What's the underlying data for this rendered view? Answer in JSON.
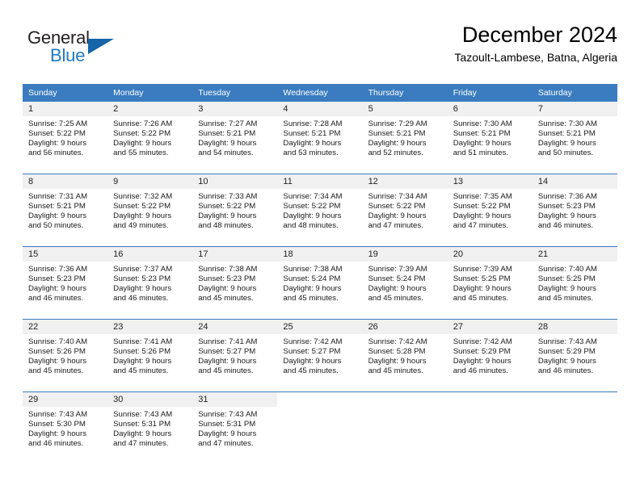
{
  "brand": {
    "name_part1": "General",
    "name_part2": "Blue",
    "triangle_color": "#1565a8",
    "blue_text_color": "#1f7ac0"
  },
  "header": {
    "title": "December 2024",
    "subtitle": "Tazoult-Lambese, Batna, Algeria"
  },
  "theme": {
    "header_bg": "#3a7cbf",
    "daynum_bg": "#f0f0f0",
    "text_color": "#1a1a1a"
  },
  "weekdays": [
    "Sunday",
    "Monday",
    "Tuesday",
    "Wednesday",
    "Thursday",
    "Friday",
    "Saturday"
  ],
  "weeks": [
    [
      {
        "day": "1",
        "sunrise": "Sunrise: 7:25 AM",
        "sunset": "Sunset: 5:22 PM",
        "daylight1": "Daylight: 9 hours",
        "daylight2": "and 56 minutes."
      },
      {
        "day": "2",
        "sunrise": "Sunrise: 7:26 AM",
        "sunset": "Sunset: 5:22 PM",
        "daylight1": "Daylight: 9 hours",
        "daylight2": "and 55 minutes."
      },
      {
        "day": "3",
        "sunrise": "Sunrise: 7:27 AM",
        "sunset": "Sunset: 5:21 PM",
        "daylight1": "Daylight: 9 hours",
        "daylight2": "and 54 minutes."
      },
      {
        "day": "4",
        "sunrise": "Sunrise: 7:28 AM",
        "sunset": "Sunset: 5:21 PM",
        "daylight1": "Daylight: 9 hours",
        "daylight2": "and 53 minutes."
      },
      {
        "day": "5",
        "sunrise": "Sunrise: 7:29 AM",
        "sunset": "Sunset: 5:21 PM",
        "daylight1": "Daylight: 9 hours",
        "daylight2": "and 52 minutes."
      },
      {
        "day": "6",
        "sunrise": "Sunrise: 7:30 AM",
        "sunset": "Sunset: 5:21 PM",
        "daylight1": "Daylight: 9 hours",
        "daylight2": "and 51 minutes."
      },
      {
        "day": "7",
        "sunrise": "Sunrise: 7:30 AM",
        "sunset": "Sunset: 5:21 PM",
        "daylight1": "Daylight: 9 hours",
        "daylight2": "and 50 minutes."
      }
    ],
    [
      {
        "day": "8",
        "sunrise": "Sunrise: 7:31 AM",
        "sunset": "Sunset: 5:21 PM",
        "daylight1": "Daylight: 9 hours",
        "daylight2": "and 50 minutes."
      },
      {
        "day": "9",
        "sunrise": "Sunrise: 7:32 AM",
        "sunset": "Sunset: 5:22 PM",
        "daylight1": "Daylight: 9 hours",
        "daylight2": "and 49 minutes."
      },
      {
        "day": "10",
        "sunrise": "Sunrise: 7:33 AM",
        "sunset": "Sunset: 5:22 PM",
        "daylight1": "Daylight: 9 hours",
        "daylight2": "and 48 minutes."
      },
      {
        "day": "11",
        "sunrise": "Sunrise: 7:34 AM",
        "sunset": "Sunset: 5:22 PM",
        "daylight1": "Daylight: 9 hours",
        "daylight2": "and 48 minutes."
      },
      {
        "day": "12",
        "sunrise": "Sunrise: 7:34 AM",
        "sunset": "Sunset: 5:22 PM",
        "daylight1": "Daylight: 9 hours",
        "daylight2": "and 47 minutes."
      },
      {
        "day": "13",
        "sunrise": "Sunrise: 7:35 AM",
        "sunset": "Sunset: 5:22 PM",
        "daylight1": "Daylight: 9 hours",
        "daylight2": "and 47 minutes."
      },
      {
        "day": "14",
        "sunrise": "Sunrise: 7:36 AM",
        "sunset": "Sunset: 5:23 PM",
        "daylight1": "Daylight: 9 hours",
        "daylight2": "and 46 minutes."
      }
    ],
    [
      {
        "day": "15",
        "sunrise": "Sunrise: 7:36 AM",
        "sunset": "Sunset: 5:23 PM",
        "daylight1": "Daylight: 9 hours",
        "daylight2": "and 46 minutes."
      },
      {
        "day": "16",
        "sunrise": "Sunrise: 7:37 AM",
        "sunset": "Sunset: 5:23 PM",
        "daylight1": "Daylight: 9 hours",
        "daylight2": "and 46 minutes."
      },
      {
        "day": "17",
        "sunrise": "Sunrise: 7:38 AM",
        "sunset": "Sunset: 5:23 PM",
        "daylight1": "Daylight: 9 hours",
        "daylight2": "and 45 minutes."
      },
      {
        "day": "18",
        "sunrise": "Sunrise: 7:38 AM",
        "sunset": "Sunset: 5:24 PM",
        "daylight1": "Daylight: 9 hours",
        "daylight2": "and 45 minutes."
      },
      {
        "day": "19",
        "sunrise": "Sunrise: 7:39 AM",
        "sunset": "Sunset: 5:24 PM",
        "daylight1": "Daylight: 9 hours",
        "daylight2": "and 45 minutes."
      },
      {
        "day": "20",
        "sunrise": "Sunrise: 7:39 AM",
        "sunset": "Sunset: 5:25 PM",
        "daylight1": "Daylight: 9 hours",
        "daylight2": "and 45 minutes."
      },
      {
        "day": "21",
        "sunrise": "Sunrise: 7:40 AM",
        "sunset": "Sunset: 5:25 PM",
        "daylight1": "Daylight: 9 hours",
        "daylight2": "and 45 minutes."
      }
    ],
    [
      {
        "day": "22",
        "sunrise": "Sunrise: 7:40 AM",
        "sunset": "Sunset: 5:26 PM",
        "daylight1": "Daylight: 9 hours",
        "daylight2": "and 45 minutes."
      },
      {
        "day": "23",
        "sunrise": "Sunrise: 7:41 AM",
        "sunset": "Sunset: 5:26 PM",
        "daylight1": "Daylight: 9 hours",
        "daylight2": "and 45 minutes."
      },
      {
        "day": "24",
        "sunrise": "Sunrise: 7:41 AM",
        "sunset": "Sunset: 5:27 PM",
        "daylight1": "Daylight: 9 hours",
        "daylight2": "and 45 minutes."
      },
      {
        "day": "25",
        "sunrise": "Sunrise: 7:42 AM",
        "sunset": "Sunset: 5:27 PM",
        "daylight1": "Daylight: 9 hours",
        "daylight2": "and 45 minutes."
      },
      {
        "day": "26",
        "sunrise": "Sunrise: 7:42 AM",
        "sunset": "Sunset: 5:28 PM",
        "daylight1": "Daylight: 9 hours",
        "daylight2": "and 45 minutes."
      },
      {
        "day": "27",
        "sunrise": "Sunrise: 7:42 AM",
        "sunset": "Sunset: 5:29 PM",
        "daylight1": "Daylight: 9 hours",
        "daylight2": "and 46 minutes."
      },
      {
        "day": "28",
        "sunrise": "Sunrise: 7:43 AM",
        "sunset": "Sunset: 5:29 PM",
        "daylight1": "Daylight: 9 hours",
        "daylight2": "and 46 minutes."
      }
    ],
    [
      {
        "day": "29",
        "sunrise": "Sunrise: 7:43 AM",
        "sunset": "Sunset: 5:30 PM",
        "daylight1": "Daylight: 9 hours",
        "daylight2": "and 46 minutes."
      },
      {
        "day": "30",
        "sunrise": "Sunrise: 7:43 AM",
        "sunset": "Sunset: 5:31 PM",
        "daylight1": "Daylight: 9 hours",
        "daylight2": "and 47 minutes."
      },
      {
        "day": "31",
        "sunrise": "Sunrise: 7:43 AM",
        "sunset": "Sunset: 5:31 PM",
        "daylight1": "Daylight: 9 hours",
        "daylight2": "and 47 minutes."
      },
      {
        "day": "",
        "sunrise": "",
        "sunset": "",
        "daylight1": "",
        "daylight2": ""
      },
      {
        "day": "",
        "sunrise": "",
        "sunset": "",
        "daylight1": "",
        "daylight2": ""
      },
      {
        "day": "",
        "sunrise": "",
        "sunset": "",
        "daylight1": "",
        "daylight2": ""
      },
      {
        "day": "",
        "sunrise": "",
        "sunset": "",
        "daylight1": "",
        "daylight2": ""
      }
    ]
  ]
}
